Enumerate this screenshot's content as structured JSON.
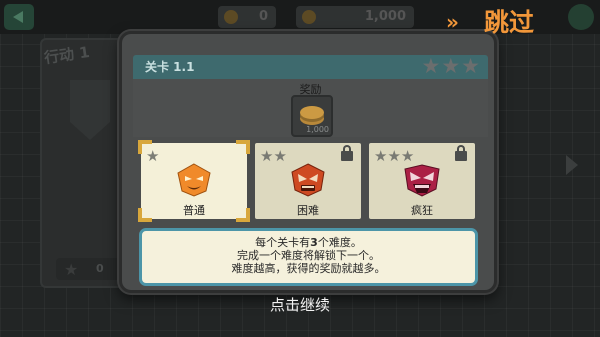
{
  "background": {
    "top_bar": {
      "stat1_value": "0",
      "stat2_value": "1,000"
    },
    "card_title": "行动 1",
    "bottom_value": "0"
  },
  "modal": {
    "level_title": "关卡 1.1",
    "header_stars": 3,
    "reward": {
      "label": "奖励",
      "amount": "1,000",
      "icon": "coin-stack-icon"
    },
    "difficulties": [
      {
        "label": "普通",
        "stars": 1,
        "locked": false,
        "selected": true,
        "color": "#f08a2a"
      },
      {
        "label": "困难",
        "stars": 2,
        "locked": true,
        "selected": false,
        "color": "#d84a1f"
      },
      {
        "label": "疯狂",
        "stars": 3,
        "locked": true,
        "selected": false,
        "color": "#b31d45"
      }
    ],
    "info": {
      "line1_prefix": "每个关卡有",
      "line1_bold": "3",
      "line1_suffix": "个难度。",
      "line2": "完成一个难度将解锁下一个。",
      "line3": "难度越高，获得的奖励就越多。"
    }
  },
  "continue_text": "点击继续",
  "skip": {
    "arrows": "»",
    "label": "跳过"
  },
  "colors": {
    "accent_orange": "#f2973a",
    "header_teal": "#3e6a6e",
    "info_border": "#4c95a8",
    "select_gold": "#d8a73c"
  }
}
